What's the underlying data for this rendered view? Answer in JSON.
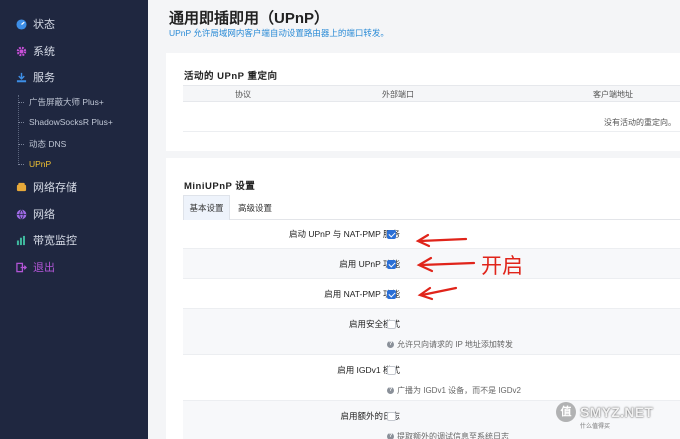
{
  "sidebar": {
    "items": [
      {
        "label": "状态",
        "icon": "dashboard-icon",
        "color": "#3d8ee6"
      },
      {
        "label": "系统",
        "icon": "gear-icon",
        "color": "#c84fd8"
      },
      {
        "label": "服务",
        "icon": "download-icon",
        "color": "#3d8ee6"
      }
    ],
    "sub_items": [
      {
        "label": "广告屏蔽大师 Plus+"
      },
      {
        "label": "ShadowSocksR Plus+"
      },
      {
        "label": "动态 DNS"
      },
      {
        "label": "UPnP"
      }
    ],
    "items2": [
      {
        "label": "网络存储",
        "icon": "storage-icon",
        "color": "#e7a93a"
      },
      {
        "label": "网络",
        "icon": "globe-icon",
        "color": "#a06be8"
      },
      {
        "label": "带宽监控",
        "icon": "bar-chart-icon",
        "color": "#3fb99e"
      }
    ],
    "logout": {
      "label": "退出",
      "icon": "logout-icon",
      "color": "#b255d6"
    },
    "active_color": "#f1c232"
  },
  "page": {
    "title": "通用即插即用（UPnP）",
    "description": "UPnP 允许局域网内客户端自动设置路由器上的端口转发。"
  },
  "redirects": {
    "title": "活动的 UPnP 重定向",
    "columns": [
      "协议",
      "外部端口",
      "客户端地址"
    ],
    "empty_text": "没有活动的重定向。"
  },
  "settings": {
    "title": "MiniUPnP 设置",
    "tabs": [
      "基本设置",
      "高级设置"
    ],
    "rows": [
      {
        "label": "启动 UPnP 与 NAT-PMP 服务",
        "checked": true,
        "hint": ""
      },
      {
        "label": "启用 UPnP 功能",
        "checked": true,
        "hint": ""
      },
      {
        "label": "启用 NAT-PMP 功能",
        "checked": true,
        "hint": ""
      },
      {
        "label": "启用安全模式",
        "checked": false,
        "hint": "允许只向请求的 IP 地址添加转发"
      },
      {
        "label": "启用 IGDv1 模式",
        "checked": false,
        "hint": "广播为 IGDv1 设备，而不是 IGDv2"
      },
      {
        "label": "启用额外的日志",
        "checked": false,
        "hint": "提取额外的调试信息至系统日志"
      }
    ]
  },
  "annotation": {
    "text": "开启",
    "color": "#e0241a"
  },
  "watermark": {
    "badge": "值",
    "text": "SMYZ.NET",
    "sub": "什么值得买"
  },
  "colors": {
    "sidebar_bg": "#1f2740",
    "accent": "#2b6fd6",
    "link": "#2a8bd6"
  }
}
